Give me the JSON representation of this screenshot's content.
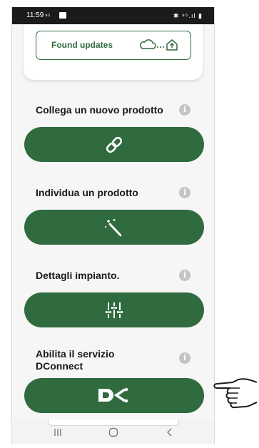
{
  "status_bar": {
    "time": "11:59",
    "left_indicators": "⁹⁵",
    "right_indicators": "✱ ⁹⁵.ıl ▮"
  },
  "updates": {
    "label": "Found updates"
  },
  "sections": [
    {
      "label": "Collega un nuovo prodotto",
      "button_icon": "link-icon"
    },
    {
      "label": "Individua un prodotto",
      "button_icon": "magic-wand-icon"
    },
    {
      "label": "Dettagli impianto.",
      "button_icon": "sliders-icon"
    },
    {
      "label": "Abilita il servizio DConnect",
      "button_icon": "dconnect-logo-icon"
    }
  ],
  "colors": {
    "primary": "#2f6b3e",
    "info": "#c4c4c4",
    "background": "#f6f6f6"
  }
}
